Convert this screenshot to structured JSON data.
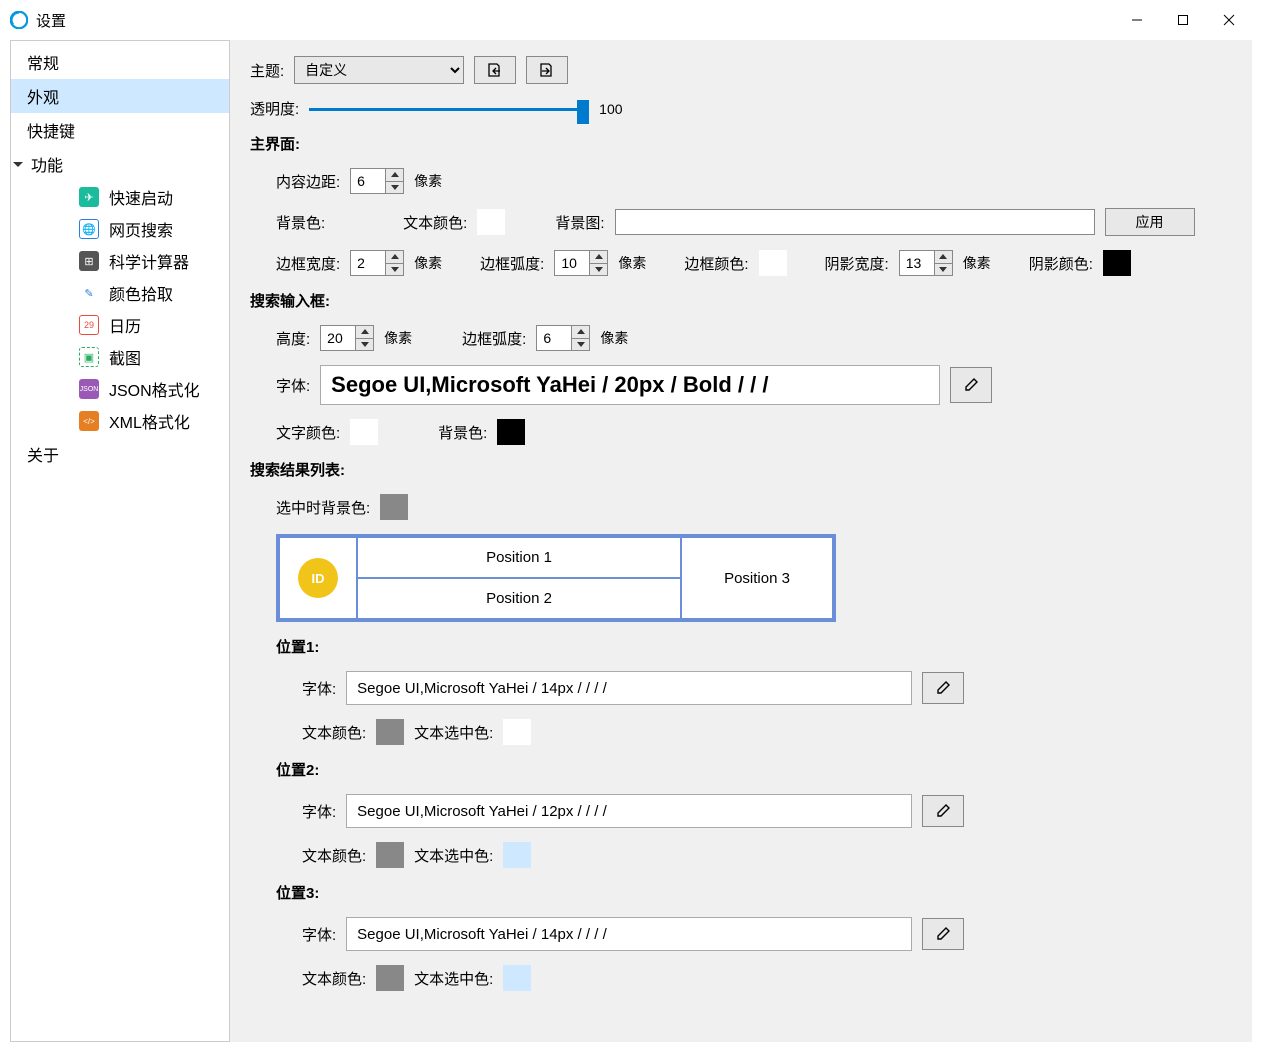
{
  "title": "设置",
  "sidebar": {
    "items": [
      {
        "label": "常规"
      },
      {
        "label": "外观"
      },
      {
        "label": "快捷键"
      },
      {
        "label": "功能"
      },
      {
        "label": "关于"
      }
    ],
    "sub_items": [
      {
        "label": "快速启动"
      },
      {
        "label": "网页搜索"
      },
      {
        "label": "科学计算器"
      },
      {
        "label": "颜色拾取"
      },
      {
        "label": "日历"
      },
      {
        "label": "截图"
      },
      {
        "label": "JSON格式化"
      },
      {
        "label": "XML格式化"
      }
    ]
  },
  "theme": {
    "label": "主题:",
    "value": "自定义"
  },
  "opacity": {
    "label": "透明度:",
    "value": "100",
    "percent": 100
  },
  "main_ui": {
    "header": "主界面:",
    "padding_label": "内容边距:",
    "padding_value": "6",
    "pixel_unit": "像素",
    "bg_label": "背景色:",
    "bg_color": "#000000",
    "text_label": "文本颜色:",
    "text_color": "#ffffff",
    "bgimg_label": "背景图:",
    "bgimg_value": "",
    "apply_label": "应用",
    "border_w_label": "边框宽度:",
    "border_w_value": "2",
    "border_r_label": "边框弧度:",
    "border_r_value": "10",
    "border_c_label": "边框颜色:",
    "border_c_color": "#ffffff",
    "shadow_w_label": "阴影宽度:",
    "shadow_w_value": "13",
    "shadow_c_label": "阴影颜色:",
    "shadow_c_color": "#000000"
  },
  "search_input": {
    "header": "搜索输入框:",
    "height_label": "高度:",
    "height_value": "20",
    "radius_label": "边框弧度:",
    "radius_value": "6",
    "font_label": "字体:",
    "font_value": "Segoe UI,Microsoft YaHei / 20px / Bold /  /  /",
    "text_c_label": "文字颜色:",
    "text_c_color": "#ffffff",
    "bg_c_label": "背景色:",
    "bg_c_color": "#000000"
  },
  "result_list": {
    "header": "搜索结果列表:",
    "sel_bg_label": "选中时背景色:",
    "sel_bg_color": "#888888",
    "preview": {
      "id": "ID",
      "pos1": "Position 1",
      "pos2": "Position 2",
      "pos3": "Position 3"
    }
  },
  "positions": [
    {
      "header": "位置1:",
      "font_label": "字体:",
      "font_value": "Segoe UI,Microsoft YaHei / 14px /  /  /  /",
      "text_c_label": "文本颜色:",
      "text_c_color": "#888888",
      "sel_c_label": "文本选中色:",
      "sel_c_color": "#ffffff"
    },
    {
      "header": "位置2:",
      "font_label": "字体:",
      "font_value": "Segoe UI,Microsoft YaHei / 12px /  /  /  /",
      "text_c_label": "文本颜色:",
      "text_c_color": "#888888",
      "sel_c_label": "文本选中色:",
      "sel_c_color": "#cde8ff"
    },
    {
      "header": "位置3:",
      "font_label": "字体:",
      "font_value": "Segoe UI,Microsoft YaHei / 14px /  /  /  /",
      "text_c_label": "文本颜色:",
      "text_c_color": "#888888",
      "sel_c_label": "文本选中色:",
      "sel_c_color": "#cde8ff"
    }
  ]
}
